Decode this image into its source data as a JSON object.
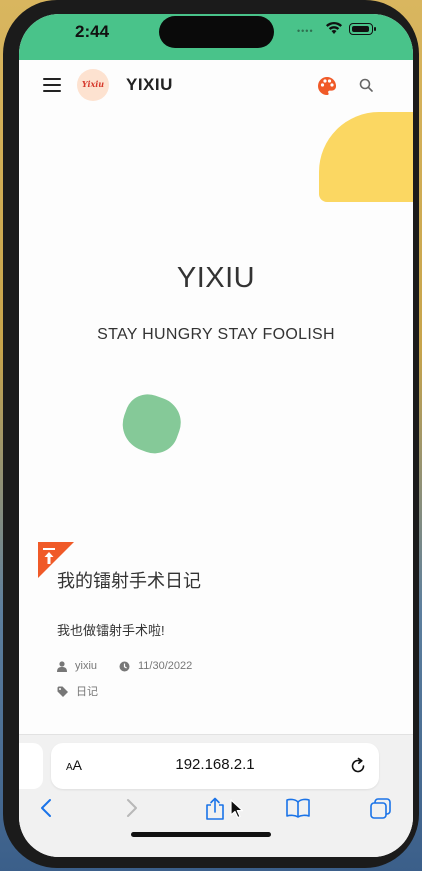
{
  "status_bar": {
    "time": "2:44",
    "signal_dots": "••••"
  },
  "navbar": {
    "site_title": "YIXIU",
    "avatar_text": "Yixiu"
  },
  "hero": {
    "title": "YIXIU",
    "subtitle": "STAY HUNGRY STAY FOOLISH"
  },
  "post": {
    "title": "我的镭射手术日记",
    "excerpt": "我也做镭射手术啦!",
    "author": "yixiu",
    "date": "11/30/2022",
    "tag": "日记"
  },
  "browser": {
    "text_size_label_small": "A",
    "text_size_label_large": "A",
    "url": "192.168.2.1"
  },
  "colors": {
    "status_bar": "#49c38a",
    "blob_yellow": "#fbd762",
    "blob_green": "#85c998",
    "accent": "#f05a28",
    "ios_blue": "#1a73e8"
  },
  "icons": [
    "hamburger-icon",
    "palette-icon",
    "search-icon",
    "pin-top-icon",
    "user-icon",
    "clock-icon",
    "tag-icon",
    "reload-icon",
    "back-icon",
    "forward-icon",
    "share-icon",
    "bookmarks-icon",
    "tabs-icon"
  ]
}
